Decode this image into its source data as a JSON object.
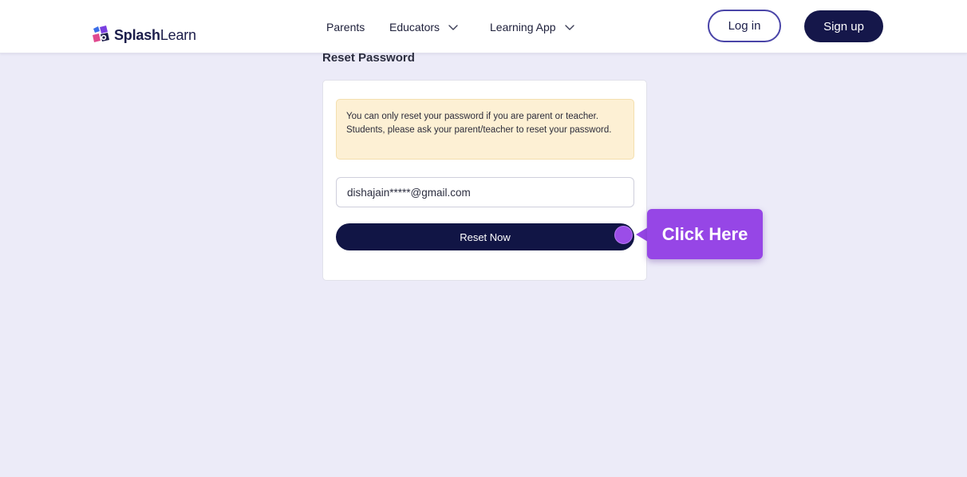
{
  "brand": {
    "name_part1": "Splash",
    "name_part2": "Learn"
  },
  "nav": {
    "parents": "Parents",
    "educators": "Educators",
    "learning_app": "Learning App"
  },
  "header_actions": {
    "login": "Log in",
    "signup": "Sign up"
  },
  "page": {
    "title": "Reset Password",
    "notice": "You can only reset your password if you are parent or teacher. Students, please ask your parent/teacher to reset your password.",
    "email_value": "dishajain*****@gmail.com",
    "reset_button": "Reset Now"
  },
  "tooltip": {
    "label": "Click Here"
  },
  "icons": {
    "educators_dropdown": "chevron-down-icon",
    "app_dropdown": "chevron-down-icon",
    "logo": "splashlearn-logo-icon"
  },
  "colors": {
    "brand_navy": "#15174a",
    "accent_purple": "#9646e6",
    "page_bg": "#ecebf8",
    "notice_bg": "#fdf0d4"
  }
}
